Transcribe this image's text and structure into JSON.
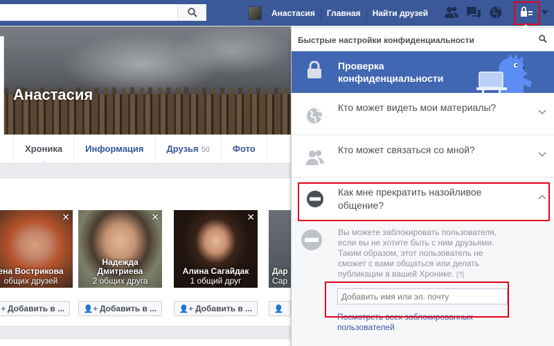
{
  "topbar": {
    "search_placeholder": "",
    "nav": [
      "Анастасия",
      "Главная",
      "Найти друзей"
    ]
  },
  "profile": {
    "name": "Анастасия"
  },
  "tabs": [
    {
      "label": "Хроника",
      "active": true
    },
    {
      "label": "Информация"
    },
    {
      "label": "Друзья",
      "count": "50"
    },
    {
      "label": "Фото"
    }
  ],
  "people": [
    {
      "name_line1": "ена Вострикова",
      "name_line2": "",
      "mutual": "общих друзей",
      "button": "Добавить в ..."
    },
    {
      "name_line1": "Надежда",
      "name_line2": "Дмитриева",
      "mutual": "2 общих друга",
      "button": "Добавить в ..."
    },
    {
      "name_line1": "Алина Сагайдак",
      "name_line2": "",
      "mutual": "1 общий друг",
      "button": "Добавить в ..."
    },
    {
      "name_line1": "Дар",
      "name_line2": "",
      "mutual": "Сар",
      "button": ""
    }
  ],
  "privacy": {
    "title": "Быстрые настройки конфиденциальности",
    "checkup": "Проверка конфиденциальности",
    "rows": [
      {
        "text": "Кто может видеть мои материалы?"
      },
      {
        "text": "Кто может связаться со мной?"
      },
      {
        "text": "Как мне прекратить назойливое общение?"
      }
    ],
    "expanded_text": "Вы можете заблокировать пользователя, если вы не хотите быть с ним друзьями. Таким образом, этот пользователь не сможет с вами общаться или делать публикации в вашей Хронике.",
    "help": "[?]",
    "input_placeholder": "Добавить имя или эл. почту",
    "link": "Посмотреть всех заблокированных пользователей"
  },
  "colors": {
    "brand": "#3b5998",
    "checkup_bg": "#4267b2",
    "highlight": "#e3001b"
  }
}
